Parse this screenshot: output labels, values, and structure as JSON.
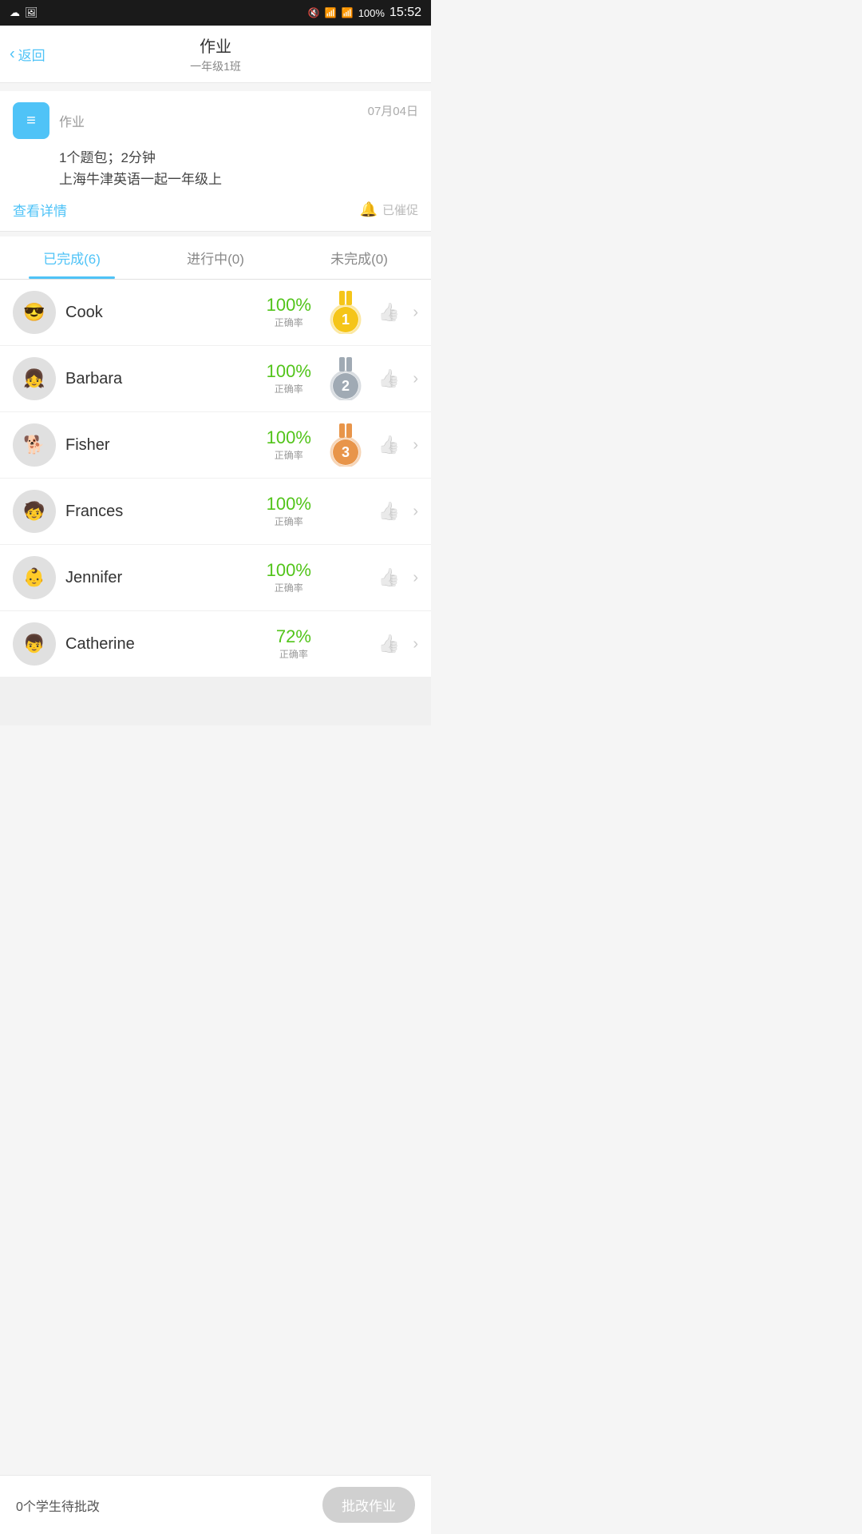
{
  "statusBar": {
    "time": "15:52",
    "battery": "100%",
    "icons": [
      "cloud",
      "image",
      "bluetooth",
      "mute",
      "wifi",
      "signal"
    ]
  },
  "header": {
    "title": "作业",
    "subtitle": "一年级1班",
    "backLabel": "返回"
  },
  "assignment": {
    "label": "作业",
    "date": "07月04日",
    "line1": "1个题包；2分钟",
    "line2": "上海牛津英语一起一年级上",
    "viewDetail": "查看详情",
    "reminded": "已催促",
    "icon": "≡"
  },
  "tabs": [
    {
      "label": "已完成(6)",
      "active": true
    },
    {
      "label": "进行中(0)",
      "active": false
    },
    {
      "label": "未完成(0)",
      "active": false
    }
  ],
  "students": [
    {
      "name": "Cook",
      "score": "100%",
      "scoreSub": "正确率",
      "medal": 1,
      "avatar": "🧑"
    },
    {
      "name": "Barbara",
      "score": "100%",
      "scoreSub": "正确率",
      "medal": 2,
      "avatar": "👧"
    },
    {
      "name": "Fisher",
      "score": "100%",
      "scoreSub": "正确率",
      "medal": 3,
      "avatar": "🐶"
    },
    {
      "name": "Frances",
      "score": "100%",
      "scoreSub": "正确率",
      "medal": 0,
      "avatar": "🧒"
    },
    {
      "name": "Jennifer",
      "score": "100%",
      "scoreSub": "正确率",
      "medal": 0,
      "avatar": "👶"
    },
    {
      "name": "Catherine",
      "score": "72%",
      "scoreSub": "正确率",
      "medal": 0,
      "avatar": "👦"
    }
  ],
  "bottomBar": {
    "label": "0个学生待批改",
    "btnLabel": "批改作业"
  }
}
